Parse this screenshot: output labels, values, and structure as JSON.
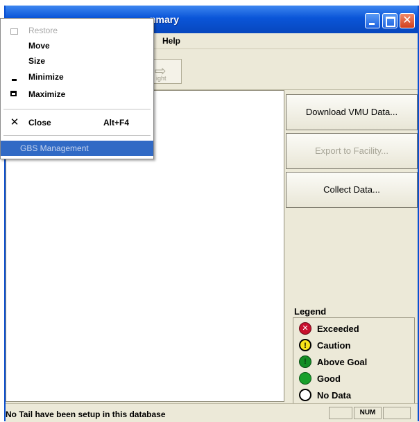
{
  "window": {
    "title": "nmary"
  },
  "menubar": {
    "help": "Help"
  },
  "toolbar": {
    "disabled_button_label": "ight",
    "disabled_button_icon": "arrow-right-icon"
  },
  "actions": {
    "download": "Download VMU Data...",
    "export": "Export to Facility...",
    "collect": "Collect Data..."
  },
  "legend": {
    "title": "Legend",
    "items": [
      {
        "label": "Exceeded",
        "icon": "exceeded-icon",
        "color": "#c8102e"
      },
      {
        "label": "Caution",
        "icon": "caution-icon",
        "color": "#f7e31a"
      },
      {
        "label": "Above Goal",
        "icon": "above-goal-icon",
        "color": "#138d25"
      },
      {
        "label": "Good",
        "icon": "good-icon",
        "color": "#19a02c"
      },
      {
        "label": "No Data",
        "icon": "no-data-icon",
        "color": "#ffffff"
      }
    ]
  },
  "system_menu": {
    "items": [
      {
        "label": "Restore",
        "icon": "restore-icon",
        "enabled": false
      },
      {
        "label": "Move",
        "enabled": true
      },
      {
        "label": "Size",
        "enabled": true
      },
      {
        "label": "Minimize",
        "icon": "minimize-icon",
        "enabled": true
      },
      {
        "label": "Maximize",
        "icon": "maximize-icon",
        "enabled": true
      },
      {
        "label": "Close",
        "icon": "close-icon",
        "shortcut": "Alt+F4",
        "enabled": true
      },
      {
        "label": "GBS Management",
        "enabled": true,
        "highlighted": true
      }
    ]
  },
  "statusbar": {
    "message": "No Tail have been setup in this database",
    "num_indicator": "NUM"
  },
  "colors": {
    "titlebar": "#0a55d8",
    "menu_highlight": "#316ac5",
    "window_bg": "#ece9d8"
  }
}
